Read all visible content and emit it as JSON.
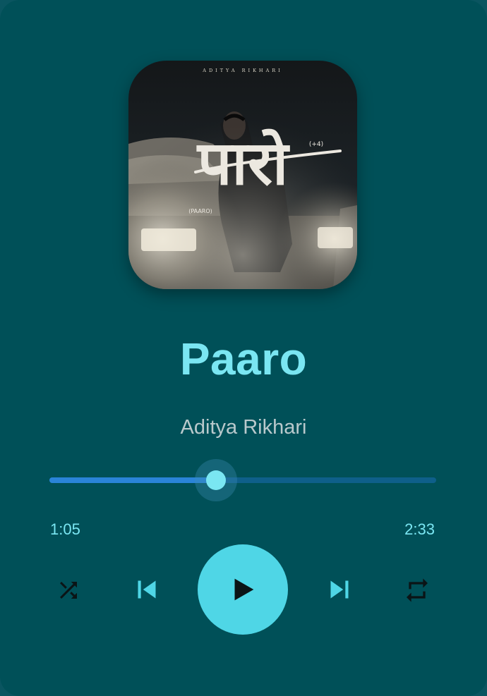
{
  "track": {
    "title": "Paaro",
    "artist": "Aditya Rikhari"
  },
  "artwork": {
    "header_text": "ADITYA RIKHARI",
    "script_title": "पारो",
    "subtitle": "(PAARO)",
    "tag": "(+4)"
  },
  "progress": {
    "elapsed": "1:05",
    "total": "2:33",
    "fraction": 0.43
  },
  "controls": {
    "shuffle_icon": "shuffle-icon",
    "previous_icon": "skip-previous-icon",
    "play_icon": "play-icon",
    "next_icon": "skip-next-icon",
    "repeat_icon": "repeat-icon"
  },
  "colors": {
    "background": "#005058",
    "accent": "#7ae6f2",
    "play_button": "#4fd6e6",
    "track_fill": "#2a84d8",
    "track_rest": "#0e5f8a",
    "artist_text": "#b9c9cc"
  }
}
